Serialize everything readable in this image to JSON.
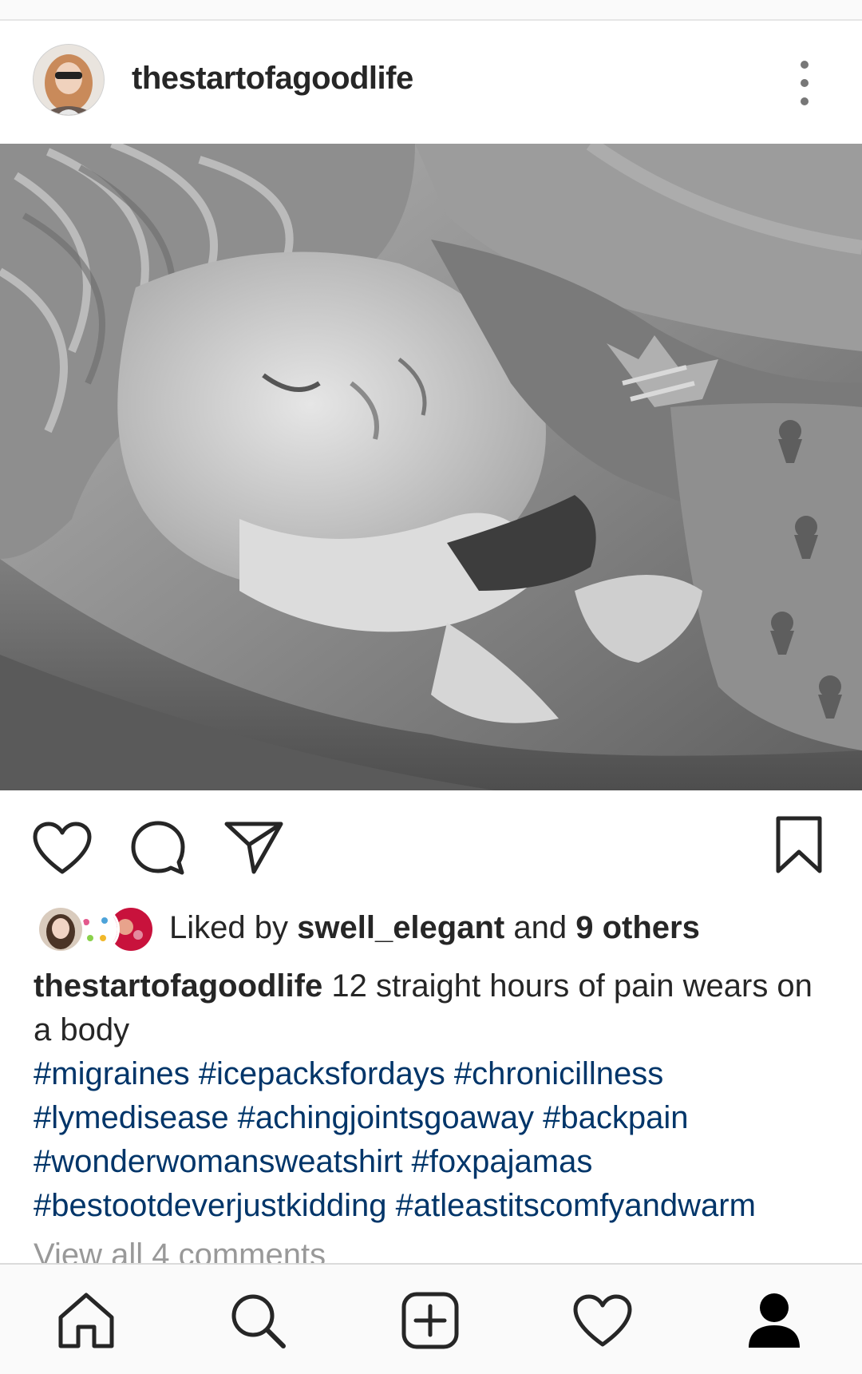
{
  "post": {
    "username": "thestartofagoodlife",
    "likes": {
      "prefix": "Liked by ",
      "user": "swell_elegant",
      "middle": " and ",
      "others": "9 others"
    },
    "caption": {
      "author": "thestartofagoodlife",
      "text": " 12 straight hours of pain wears on a body",
      "hashtags": "#migraines #icepacksfordays #chronicillness #lymedisease #achingjointsgoaway #backpain #wonderwomansweatshirt #foxpajamas #bestootdeverjustkidding #atleastitscomfyandwarm"
    },
    "view_comments": "View all 4 comments"
  },
  "actions": [
    "heart-icon",
    "comment-icon",
    "share-icon",
    "bookmark-icon"
  ],
  "nav": [
    "home-icon",
    "search-icon",
    "new-post-icon",
    "activity-icon",
    "profile-icon"
  ],
  "colors": {
    "text": "#262626",
    "hashtag": "#003569",
    "muted": "#999999",
    "nav_bg": "#fafafa"
  }
}
